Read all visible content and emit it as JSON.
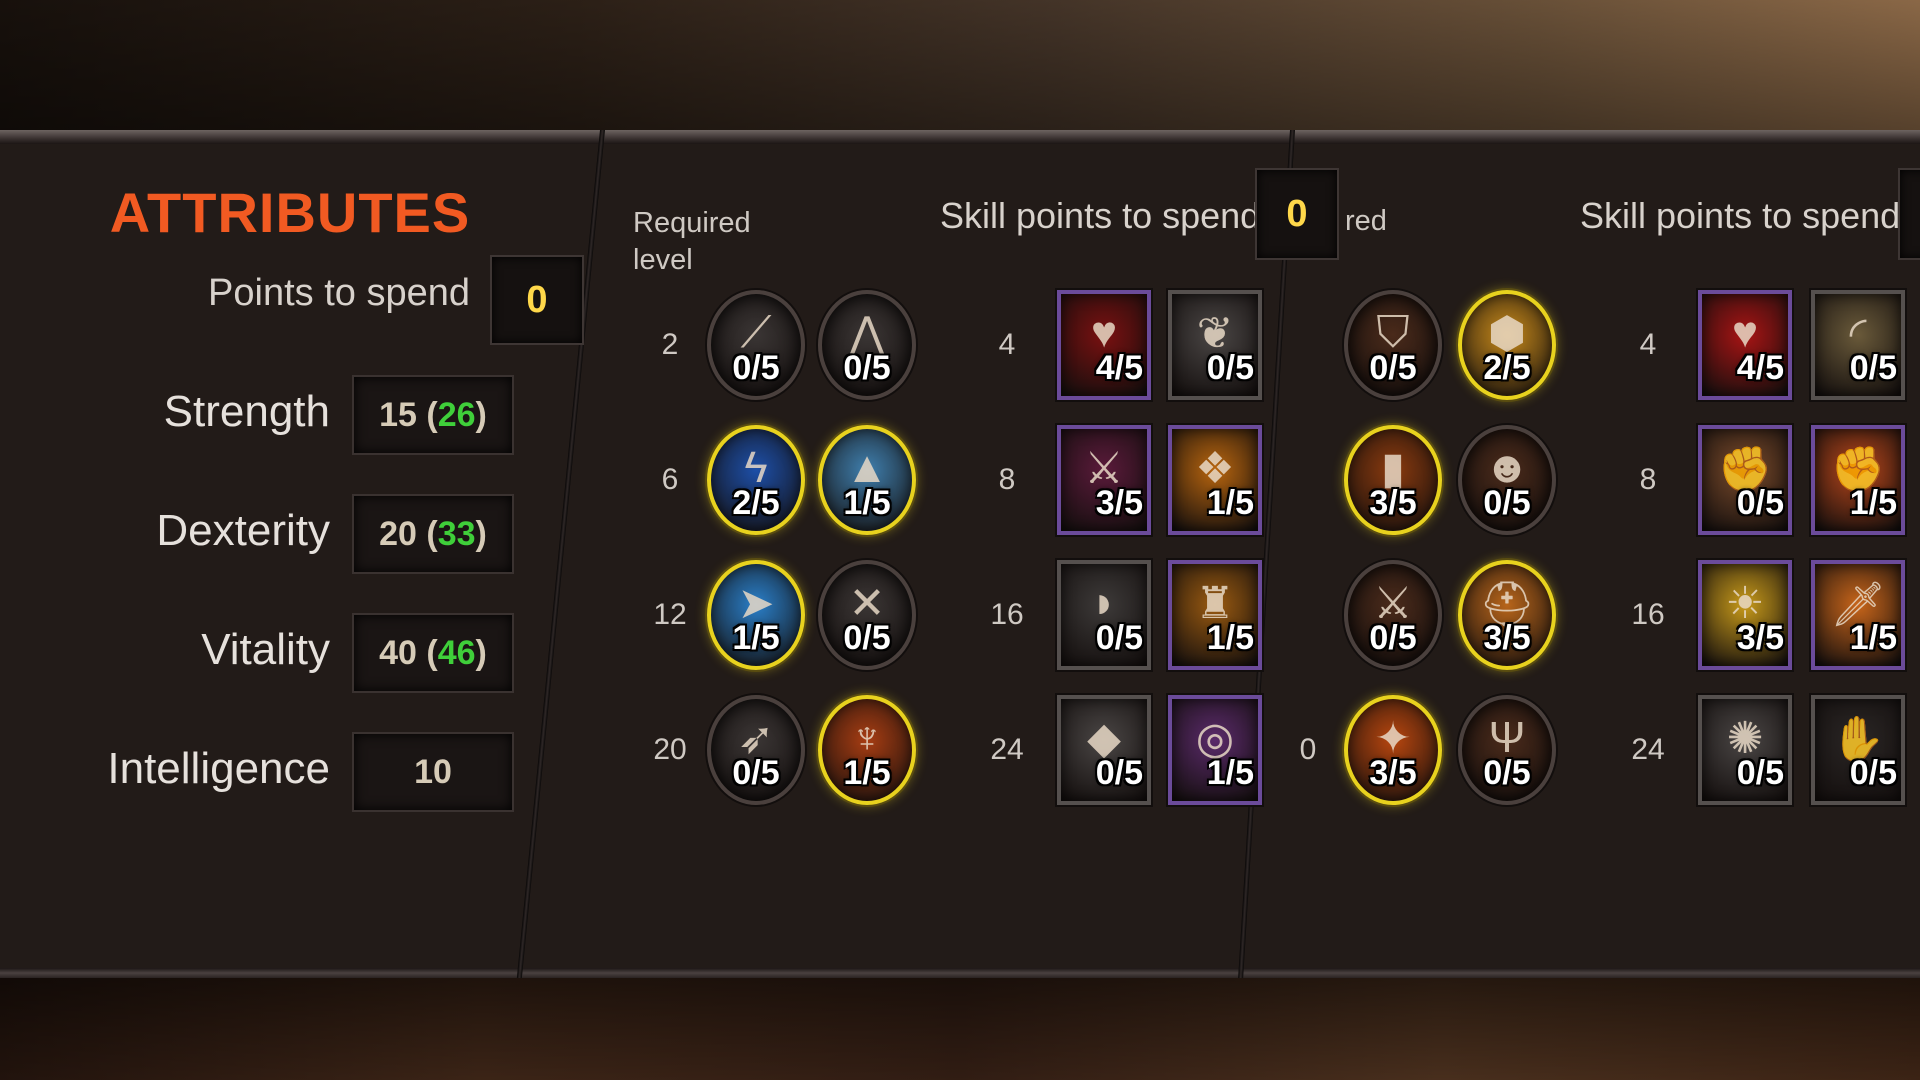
{
  "attributes": {
    "title": "ATTRIBUTES",
    "points_label": "Points to spend",
    "points_value": "0",
    "stats": [
      {
        "name": "Strength",
        "base": "15",
        "bonus": "26"
      },
      {
        "name": "Dexterity",
        "base": "20",
        "bonus": "33"
      },
      {
        "name": "Vitality",
        "base": "40",
        "bonus": "46"
      },
      {
        "name": "Intelligence",
        "base": "10",
        "bonus": ""
      }
    ]
  },
  "skills_panel_1": {
    "required_label": "Required\nlevel",
    "skill_points_label": "Skill points to spend",
    "skill_points_value": "0",
    "left_levels": [
      "2",
      "6",
      "12",
      "20"
    ],
    "right_levels": [
      "4",
      "8",
      "16",
      "24"
    ],
    "left_icons": [
      {
        "count": "0/5",
        "icon": "slash-icon",
        "active": false,
        "bg": "#3a3534"
      },
      {
        "count": "0/5",
        "icon": "teeth-icon",
        "active": false,
        "bg": "#3a3534"
      },
      {
        "count": "2/5",
        "icon": "lightning-icon",
        "active": true,
        "bg": "#1d4fa8"
      },
      {
        "count": "1/5",
        "icon": "wolf-howl-icon",
        "active": true,
        "bg": "#3f7fae"
      },
      {
        "count": "1/5",
        "icon": "dash-icon",
        "active": true,
        "bg": "#2a7fc9"
      },
      {
        "count": "0/5",
        "icon": "crossed-claws-icon",
        "active": false,
        "bg": "#3a3534"
      },
      {
        "count": "0/5",
        "icon": "arrows-icon",
        "active": false,
        "bg": "#3a3534"
      },
      {
        "count": "1/5",
        "icon": "demon-icon",
        "active": true,
        "bg": "#a83d12"
      }
    ],
    "right_icons": [
      {
        "count": "4/5",
        "icon": "heart-icon",
        "purple": true,
        "bg": "#7a1010"
      },
      {
        "count": "0/5",
        "icon": "feather-icon",
        "purple": false,
        "bg": "#4a4645"
      },
      {
        "count": "3/5",
        "icon": "blade-icon",
        "purple": true,
        "bg": "#5a1a3a"
      },
      {
        "count": "1/5",
        "icon": "paw-icon",
        "purple": true,
        "bg": "#b8650e"
      },
      {
        "count": "0/5",
        "icon": "horn-icon",
        "purple": false,
        "bg": "#3d3a39"
      },
      {
        "count": "1/5",
        "icon": "beast-icon",
        "purple": true,
        "bg": "#9a5a10"
      },
      {
        "count": "0/5",
        "icon": "spike-icon",
        "purple": false,
        "bg": "#4a4645"
      },
      {
        "count": "1/5",
        "icon": "target-icon",
        "purple": true,
        "bg": "#5a2a6a"
      }
    ]
  },
  "skills_panel_2": {
    "required_label": "red",
    "skill_points_label": "Skill points to spend",
    "left_levels": [
      "0"
    ],
    "right_levels": [
      "4",
      "8",
      "16",
      "24"
    ],
    "left_icons": [
      {
        "count": "0/5",
        "icon": "shield-icon",
        "active": false,
        "bg": "#4a2a1a"
      },
      {
        "count": "2/5",
        "icon": "armor-icon",
        "active": true,
        "bg": "#c88a1a"
      },
      {
        "count": "3/5",
        "icon": "fire-pillar-icon",
        "active": true,
        "bg": "#8a3a0e"
      },
      {
        "count": "0/5",
        "icon": "warrior-face-icon",
        "active": false,
        "bg": "#4a2a1a"
      },
      {
        "count": "0/5",
        "icon": "crossed-swords-icon",
        "active": false,
        "bg": "#4a2a1a"
      },
      {
        "count": "3/5",
        "icon": "helmet-icon",
        "active": true,
        "bg": "#b8651a"
      },
      {
        "count": "3/5",
        "icon": "fire-axe-icon",
        "active": true,
        "bg": "#b8460e"
      },
      {
        "count": "0/5",
        "icon": "trident-icon",
        "active": false,
        "bg": "#4a2a1a"
      }
    ],
    "right_icons": [
      {
        "count": "4/5",
        "icon": "heart-icon",
        "purple": true,
        "bg": "#a81414"
      },
      {
        "count": "0/5",
        "icon": "swipe-icon",
        "purple": false,
        "bg": "#6a5a3a"
      },
      {
        "count": "0/5",
        "icon": "fist-icon",
        "purple": true,
        "bg": "#7a4a2a"
      },
      {
        "count": "1/5",
        "icon": "punch-icon",
        "purple": true,
        "bg": "#b8461a"
      },
      {
        "count": "3/5",
        "icon": "radiant-shield-icon",
        "purple": true,
        "bg": "#c89a1a"
      },
      {
        "count": "1/5",
        "icon": "flaming-sword-icon",
        "purple": true,
        "bg": "#c8651a"
      },
      {
        "count": "0/5",
        "icon": "mace-icon",
        "purple": false,
        "bg": "#4a4645"
      },
      {
        "count": "0/5",
        "icon": "dark-hand-icon",
        "purple": false,
        "bg": "#2a2625"
      }
    ]
  }
}
